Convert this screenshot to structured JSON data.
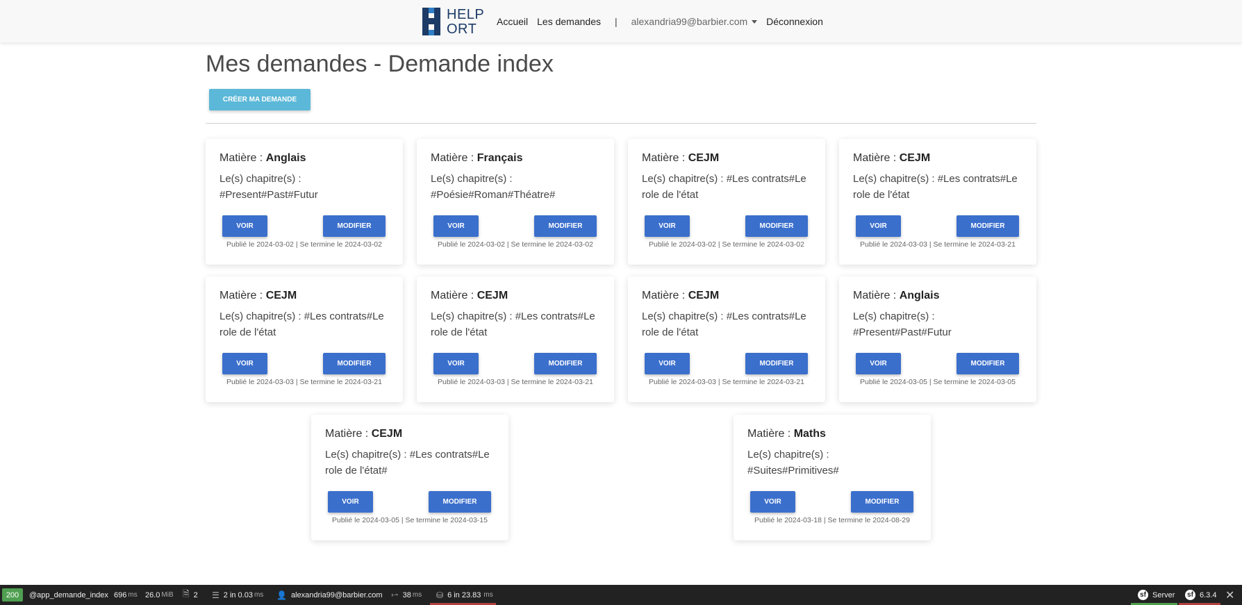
{
  "nav": {
    "brand_line1": "HELP",
    "brand_line2": "ORT",
    "home": "Accueil",
    "requests": "Les demandes",
    "separator": "|",
    "user": "alexandria99@barbier.com",
    "logout": "Déconnexion"
  },
  "page": {
    "title": "Mes demandes - Demande index",
    "create_button": "CRÉER MA DEMANDE"
  },
  "labels": {
    "subject_prefix": "Matière : ",
    "view": "VOIR",
    "edit": "MODIFIER"
  },
  "cards": [
    {
      "subject": "Anglais",
      "chapters": "Le(s) chapitre(s) : #Present#Past#Futur",
      "dates": "Publié le 2024-03-02 | Se termine le 2024-03-02"
    },
    {
      "subject": "Français",
      "chapters": "Le(s) chapitre(s) : #Poésie#Roman#Théatre#",
      "dates": "Publié le 2024-03-02 | Se termine le 2024-03-02"
    },
    {
      "subject": "CEJM",
      "chapters": "Le(s) chapitre(s) : #Les contrats#Le role de l'état",
      "dates": "Publié le 2024-03-02 | Se termine le 2024-03-02"
    },
    {
      "subject": "CEJM",
      "chapters": "Le(s) chapitre(s) : #Les contrats#Le role de l'état",
      "dates": "Publié le 2024-03-03 | Se termine le 2024-03-21"
    },
    {
      "subject": "CEJM",
      "chapters": "Le(s) chapitre(s) : #Les contrats#Le role de l'état",
      "dates": "Publié le 2024-03-03 | Se termine le 2024-03-21"
    },
    {
      "subject": "CEJM",
      "chapters": "Le(s) chapitre(s) : #Les contrats#Le role de l'état",
      "dates": "Publié le 2024-03-03 | Se termine le 2024-03-21"
    },
    {
      "subject": "CEJM",
      "chapters": "Le(s) chapitre(s) : #Les contrats#Le role de l'état",
      "dates": "Publié le 2024-03-03 | Se termine le 2024-03-21"
    },
    {
      "subject": "Anglais",
      "chapters": "Le(s) chapitre(s) : #Present#Past#Futur",
      "dates": "Publié le 2024-03-05 | Se termine le 2024-03-05"
    },
    {
      "subject": "CEJM",
      "chapters": "Le(s) chapitre(s) : #Les contrats#Le role de l'état#",
      "dates": "Publié le 2024-03-05 | Se termine le 2024-03-15"
    },
    {
      "subject": "Maths",
      "chapters": "Le(s) chapitre(s) : #Suites#Primitives#",
      "dates": "Publié le 2024-03-18 | Se termine le 2024-08-29"
    }
  ],
  "debug_toolbar": {
    "status": "200",
    "route": "@app_demande_index",
    "time": "696",
    "time_unit": "ms",
    "memory": "26.0",
    "memory_unit": "MiB",
    "requests": "2",
    "cache": "2 in 0.03",
    "cache_unit": "ms",
    "user": "alexandria99@barbier.com",
    "routing_time": "38",
    "routing_unit": "ms",
    "db": "6 in 23.83",
    "db_unit": "ms",
    "server": "Server",
    "version": "6.3.4",
    "colors": {
      "status": "#4f9f50",
      "db_alert": "#b0413e"
    }
  }
}
